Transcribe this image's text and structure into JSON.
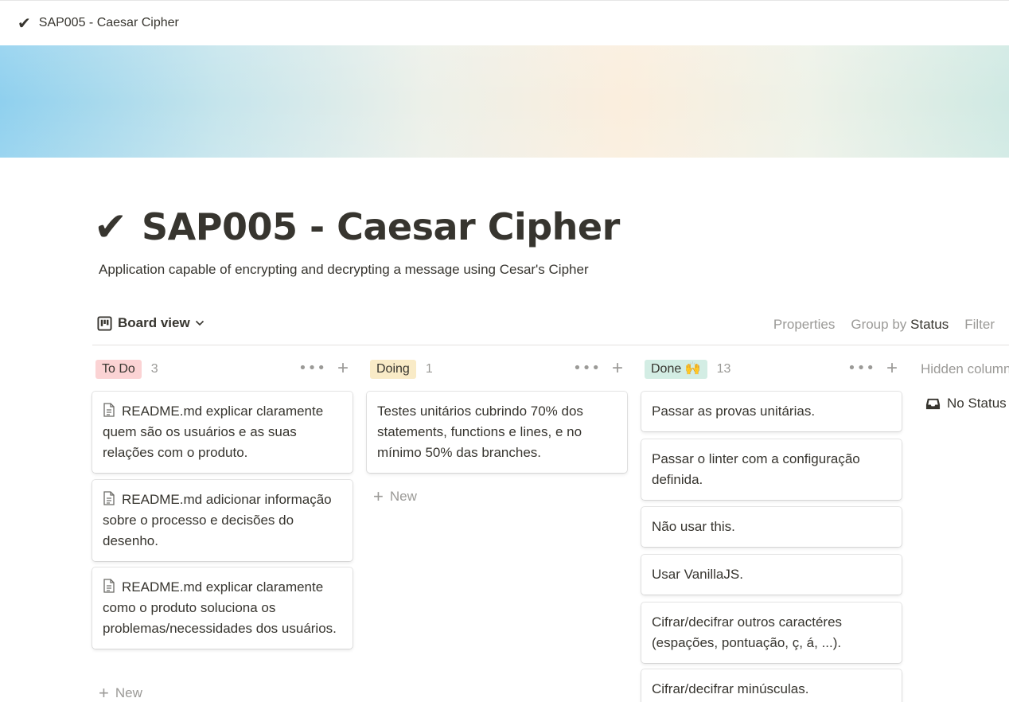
{
  "topbar": {
    "icon": "check-icon",
    "title": "SAP005 - Caesar Cipher"
  },
  "page": {
    "icon": "check-icon",
    "title": "SAP005 - Caesar Cipher",
    "description": "Application capable of encrypting and decrypting a message using Cesar's Cipher"
  },
  "view": {
    "icon": "board-icon",
    "label": "Board view",
    "actions": {
      "properties": "Properties",
      "group_by_prefix": "Group by",
      "group_by_value": "Status",
      "filter": "Filter"
    }
  },
  "columns": [
    {
      "label": "To Do",
      "count": "3",
      "color": "#fbd3d4",
      "cards": [
        "README.md explicar claramente quem são os usuários e as suas relações com o produto.",
        "README.md adicionar informação sobre o processo e decisões do desenho.",
        "README.md explicar claramente como o produto soluciona os problemas/necessidades dos usuários."
      ],
      "new_label": "New"
    },
    {
      "label": "Doing",
      "count": "1",
      "color": "#f9ebc7",
      "cards": [
        "Testes unitários cubrindo 70% dos statements, functions e lines, e no mínimo 50% das branches."
      ],
      "new_label": "New"
    },
    {
      "label": "Done 🙌",
      "count": "13",
      "color": "#d3ede4",
      "cards": [
        "Passar as provas unitárias.",
        "Passar o linter com a configuração definida.",
        "Não usar this.",
        "Usar VanillaJS.",
        "Cifrar/decifrar outros caractéres (espações, pontuação, ç, á, ...).",
        "Cifrar/decifrar minúsculas."
      ]
    }
  ],
  "hidden_columns": {
    "label": "Hidden columns",
    "no_status": "No Status",
    "icon": "inbox-icon"
  },
  "colors": {
    "text": "#37352f",
    "muted": "#9b9a97"
  }
}
